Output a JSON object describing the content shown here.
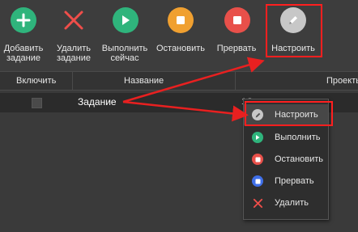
{
  "toolbar": {
    "add_line1": "Добавить",
    "add_line2": "задание",
    "delete_line1": "Удалить",
    "delete_line2": "задание",
    "run_line1": "Выполнить",
    "run_line2": "сейчас",
    "stop_label": "Остановить",
    "abort_label": "Прервать",
    "settings_label": "Настроить"
  },
  "table": {
    "columns": [
      "Включить",
      "Название",
      "Проекты"
    ],
    "rows": [
      {
        "enabled": false,
        "name": "Задание",
        "project": "1С"
      }
    ]
  },
  "context_menu": {
    "items": [
      {
        "label": "Настроить",
        "icon": "pencil-icon"
      },
      {
        "label": "Выполнить",
        "icon": "play-icon"
      },
      {
        "label": "Остановить",
        "icon": "stop-icon"
      },
      {
        "label": "Прервать",
        "icon": "abort-icon"
      },
      {
        "label": "Удалить",
        "icon": "close-icon"
      }
    ]
  },
  "colors": {
    "green": "#2fb47c",
    "red": "#e8504a",
    "orange": "#f0a030",
    "blue": "#3f6fe8",
    "gray": "#c7c7c7",
    "highlight": "#ff1f1f"
  }
}
